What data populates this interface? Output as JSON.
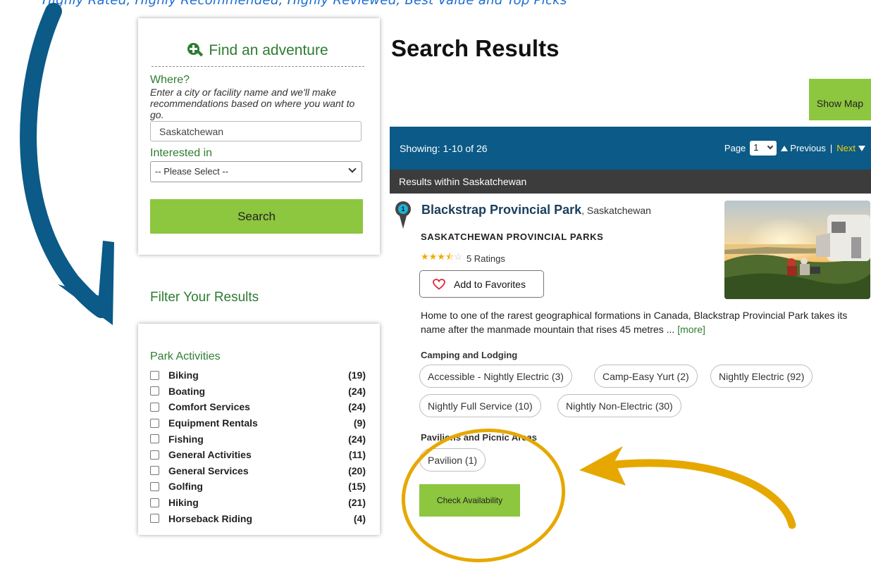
{
  "top_caption": "Highly Rated, Highly Recommended, Highly Reviewed, Best Value and Top Picks",
  "search_panel": {
    "title": "Find an adventure",
    "where_label": "Where?",
    "where_help": "Enter a city or facility name and we'll make recommendations based on where you want to go.",
    "where_value": "Saskatchewan",
    "interested_label": "Interested in",
    "interested_selected": "-- Please Select --",
    "search_button": "Search"
  },
  "filter": {
    "heading": "Filter Your Results",
    "section_title": "Park Activities",
    "activities": [
      {
        "name": "Biking",
        "count": "(19)"
      },
      {
        "name": "Boating",
        "count": "(24)"
      },
      {
        "name": "Comfort Services",
        "count": "(24)"
      },
      {
        "name": "Equipment Rentals",
        "count": "(9)"
      },
      {
        "name": "Fishing",
        "count": "(24)"
      },
      {
        "name": "General Activities",
        "count": "(11)"
      },
      {
        "name": "General Services",
        "count": "(20)"
      },
      {
        "name": "Golfing",
        "count": "(15)"
      },
      {
        "name": "Hiking",
        "count": "(21)"
      },
      {
        "name": "Horseback Riding",
        "count": "(4)"
      }
    ]
  },
  "results": {
    "title": "Search Results",
    "show_map": "Show Map",
    "showing": "Showing: 1-10 of 26",
    "page_label": "Page",
    "page_value": "1",
    "previous": "Previous",
    "separator": "|",
    "next": "Next",
    "within": "Results within Saskatchewan"
  },
  "park": {
    "marker_number": "1",
    "name": "Blackstrap Provincial Park",
    "location": ", Saskatchewan",
    "operator": "SASKATCHEWAN PROVINCIAL PARKS",
    "stars": "★★★",
    "half_star": "⯪",
    "empty_star": "☆",
    "rating": 3.5,
    "ratings_text": "5 Ratings",
    "favorites_button": "Add to Favorites",
    "description": "Home to one of the rarest geographical formations in Canada, Blackstrap Provincial Park takes its name after the manmade mountain that rises 45 metres ...",
    "more_link": "[more]",
    "camping_label": "Camping and Lodging",
    "camping_options": [
      "Accessible - Nightly Electric (3)",
      "Camp-Easy Yurt (2)",
      "Nightly Electric (92)",
      "Nightly Full Service (10)",
      "Nightly Non-Electric (30)"
    ],
    "pavilion_label": "Pavilions and Picnic Areas",
    "pavilion_options": [
      "Pavilion (1)"
    ],
    "check_button": "Check Availability"
  },
  "colors": {
    "green_text": "#2e7d32",
    "green_button": "#8dc63f",
    "results_bar": "#0b5a87",
    "within_bar": "#3c3c3c",
    "arrow_blue": "#0b5a87",
    "arrow_gold": "#e6a800",
    "next_link": "#f5cf00"
  }
}
